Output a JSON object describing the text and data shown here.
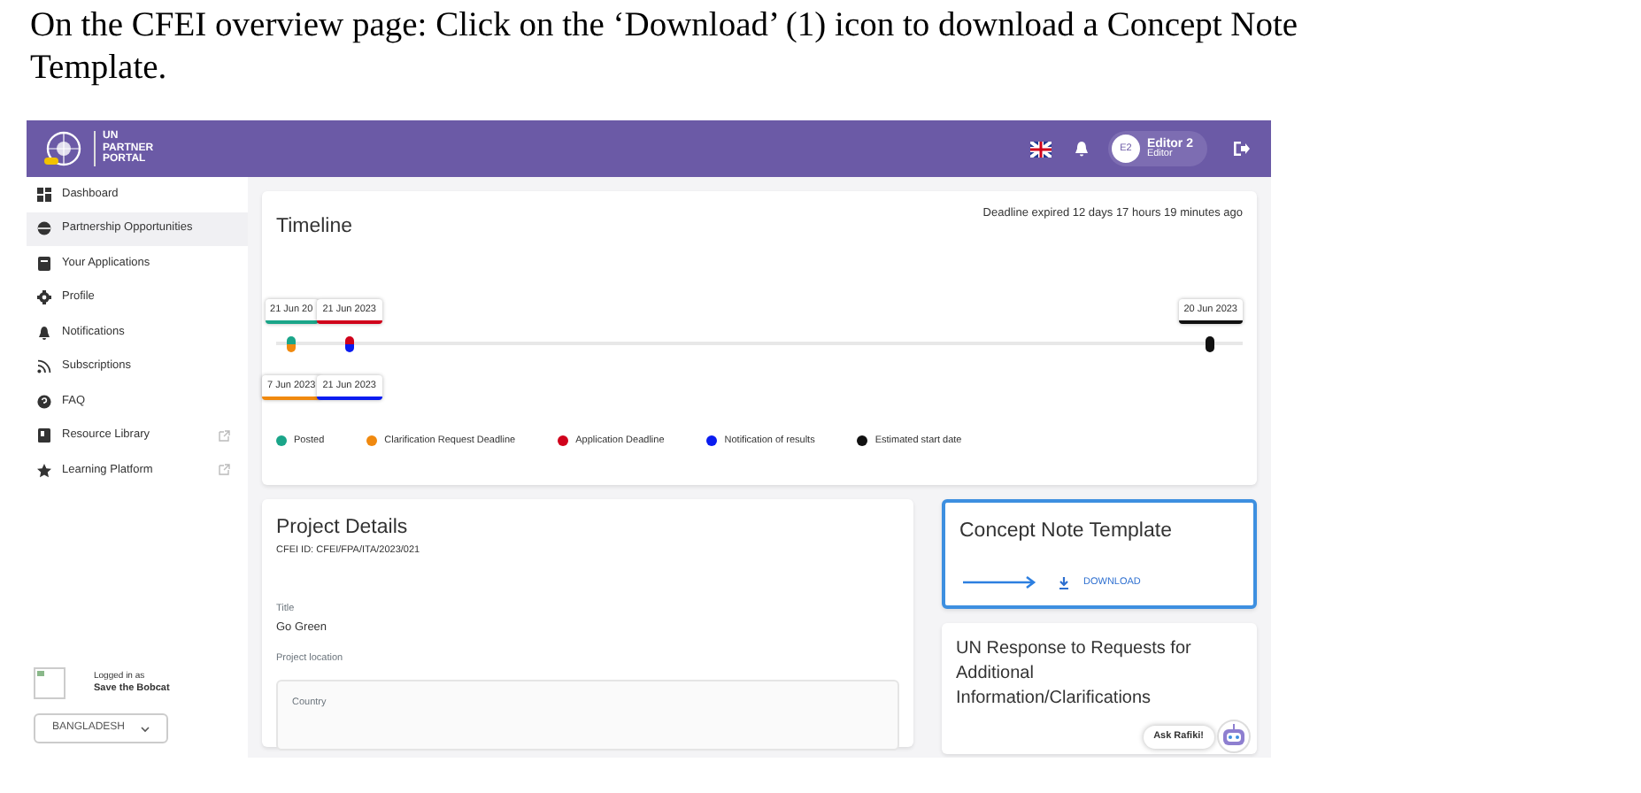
{
  "instruction": {
    "lines": [
      "On the CFEI overview page: Click on the ‘Download’ (1) icon to download a Concept Note",
      "Template."
    ]
  },
  "header": {
    "portal_name": [
      "UN",
      "PARTNER",
      "PORTAL"
    ],
    "avatar": "E2",
    "user_name": "Editor 2",
    "user_role": "Editor"
  },
  "sidebar": {
    "items": [
      {
        "label": "Dashboard",
        "selected": false,
        "external": false
      },
      {
        "label": "Partnership Opportunities",
        "selected": true,
        "external": false
      },
      {
        "label": "Your Applications",
        "selected": false,
        "external": false
      },
      {
        "label": "Profile",
        "selected": false,
        "external": false
      },
      {
        "label": "Notifications",
        "selected": false,
        "external": false
      },
      {
        "label": "Subscriptions",
        "selected": false,
        "external": false
      },
      {
        "label": "FAQ",
        "selected": false,
        "external": false
      },
      {
        "label": "Resource Library",
        "selected": false,
        "external": true
      },
      {
        "label": "Learning Platform",
        "selected": false,
        "external": true
      }
    ],
    "logged_in_label": "Logged in as",
    "organization": "Save the Bobcat",
    "country": "BANGLADESH"
  },
  "timeline": {
    "title": "Timeline",
    "deadline_note": "Deadline expired 12 days 17 hours 19 minutes ago",
    "groups": [
      {
        "dates": [
          {
            "label": "21 Jun 20",
            "color": "#1aa589"
          },
          {
            "label": "7 Jun 2023",
            "color": "#f0890f"
          }
        ]
      },
      {
        "dates": [
          {
            "label": "21 Jun 2023",
            "color": "#d0021b"
          },
          {
            "label": "21 Jun 2023",
            "color": "#0a1cf0"
          }
        ]
      },
      {
        "dates": [
          {
            "label": "20 Jun 2023",
            "color": "#111111"
          }
        ]
      }
    ],
    "legend": [
      {
        "label": "Posted",
        "color": "#1aa589"
      },
      {
        "label": "Clarification Request Deadline",
        "color": "#f0890f"
      },
      {
        "label": "Application Deadline",
        "color": "#d0021b"
      },
      {
        "label": "Notification of results",
        "color": "#0a1cf0"
      },
      {
        "label": "Estimated start date",
        "color": "#111111"
      }
    ]
  },
  "project_details": {
    "title": "Project Details",
    "cfei_id": "CFEI ID: CFEI/FPA/ITA/2023/021",
    "fields": [
      {
        "label": "Title",
        "value": "Go Green"
      },
      {
        "label": "Project location"
      }
    ],
    "location_box": {
      "label": "Country"
    }
  },
  "concept_note": {
    "title": "Concept Note Template",
    "button": "DOWNLOAD"
  },
  "un_response": {
    "title": "UN Response to Requests for Additional Information/Clarifications"
  },
  "chat": {
    "label": "Ask Rafiki!"
  }
}
